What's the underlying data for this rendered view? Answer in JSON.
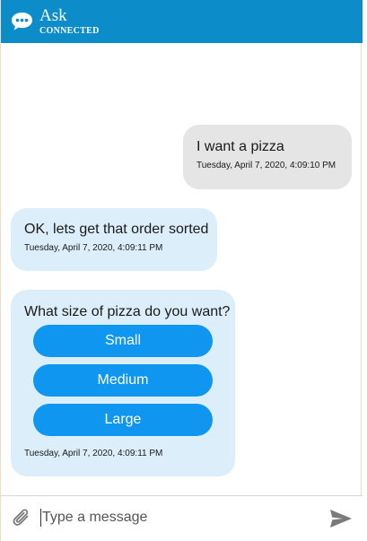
{
  "header": {
    "title": "Ask",
    "status": "CONNECTED",
    "logo_icon": "chat-bubble-icon",
    "color": "#0c8cc8"
  },
  "messages": [
    {
      "sender": "user",
      "text": "I want a pizza",
      "timestamp": "Tuesday, April 7, 2020, 4:09:10 PM"
    },
    {
      "sender": "bot",
      "text": "OK, lets get that order sorted",
      "timestamp": "Tuesday, April 7, 2020, 4:09:11 PM"
    },
    {
      "sender": "bot",
      "text": "What size of pizza do you want?",
      "choices": [
        "Small",
        "Medium",
        "Large"
      ],
      "timestamp": "Tuesday, April 7, 2020, 4:09:11 PM"
    }
  ],
  "composer": {
    "placeholder": "Type a message",
    "attach_icon": "paperclip-icon",
    "send_icon": "send-icon"
  },
  "colors": {
    "user_bubble": "#e5e5e5",
    "bot_bubble": "#ddeefb",
    "choice_button": "#0f96f0"
  }
}
